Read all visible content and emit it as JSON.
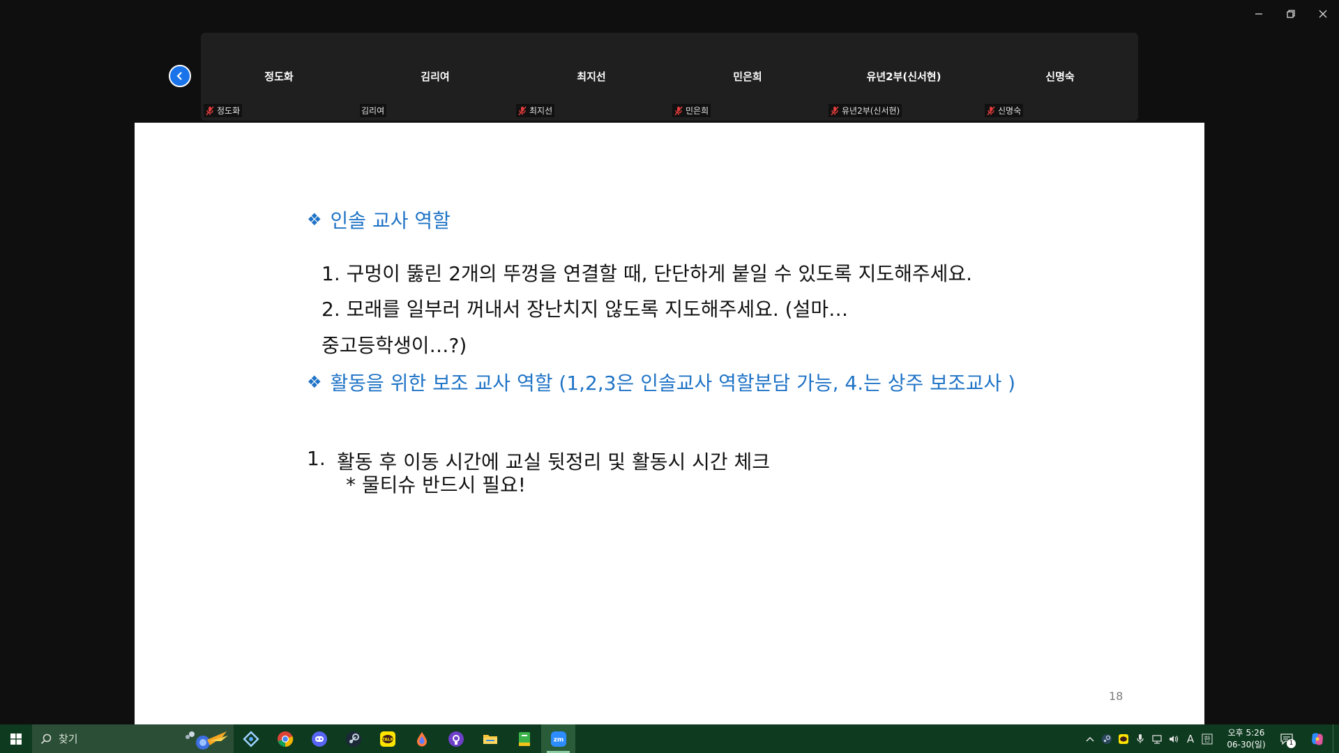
{
  "window_controls": [
    "minimize",
    "restore",
    "close"
  ],
  "participants": [
    {
      "tile_name": "정도화",
      "label": "정도화",
      "muted": true
    },
    {
      "tile_name": "김리여",
      "label": "김리여",
      "muted": false
    },
    {
      "tile_name": "최지선",
      "label": "최지선",
      "muted": true
    },
    {
      "tile_name": "민은희",
      "label": "민은희",
      "muted": true
    },
    {
      "tile_name": "유년2부(신서현)",
      "label": "유년2부(신서현)",
      "muted": true
    },
    {
      "tile_name": "신명숙",
      "label": "신명숙",
      "muted": true
    }
  ],
  "slide": {
    "heading1": "인솔 교사 역할",
    "line1": "1. 구멍이 뚫린 2개의 뚜껑을 연결할 때, 단단하게 붙일 수 있도록 지도해주세요.",
    "line2": "2. 모래를 일부러 꺼내서 장난치지 않도록 지도해주세요. (설마…",
    "line3": "중고등학생이…?)",
    "heading2": "활동을 위한 보조 교사 역할 (1,2,3은 인솔교사 역할분담 가능, 4.는 상주 보조교사 )",
    "item_number": "1.",
    "item_text": "활동 후 이동 시간에 교실 뒷정리 및 활동시 시간 체크",
    "item_note": "* 물티슈 반드시 필요!",
    "page_number": "18",
    "bullet_symbol": "❖",
    "accent_color": "#1f73c6"
  },
  "taskbar": {
    "search_placeholder": "찾기",
    "apps": [
      "settings-app",
      "chrome",
      "discord",
      "steam",
      "kakaotalk",
      "drop-app",
      "github",
      "file-explorer",
      "green-book-app",
      "zoom"
    ],
    "active_app": "zoom",
    "ime_indicator": "A",
    "ime_mode": "한",
    "clock_time": "오후 5:26",
    "clock_date": "06-30(일)",
    "notification_count": "1"
  },
  "colors": {
    "taskbar_bg": "#0e3a1f",
    "strip_bg": "#1f1f1f",
    "collapse_button": "#1a73e8",
    "muted_mic": "#e23b3b"
  }
}
